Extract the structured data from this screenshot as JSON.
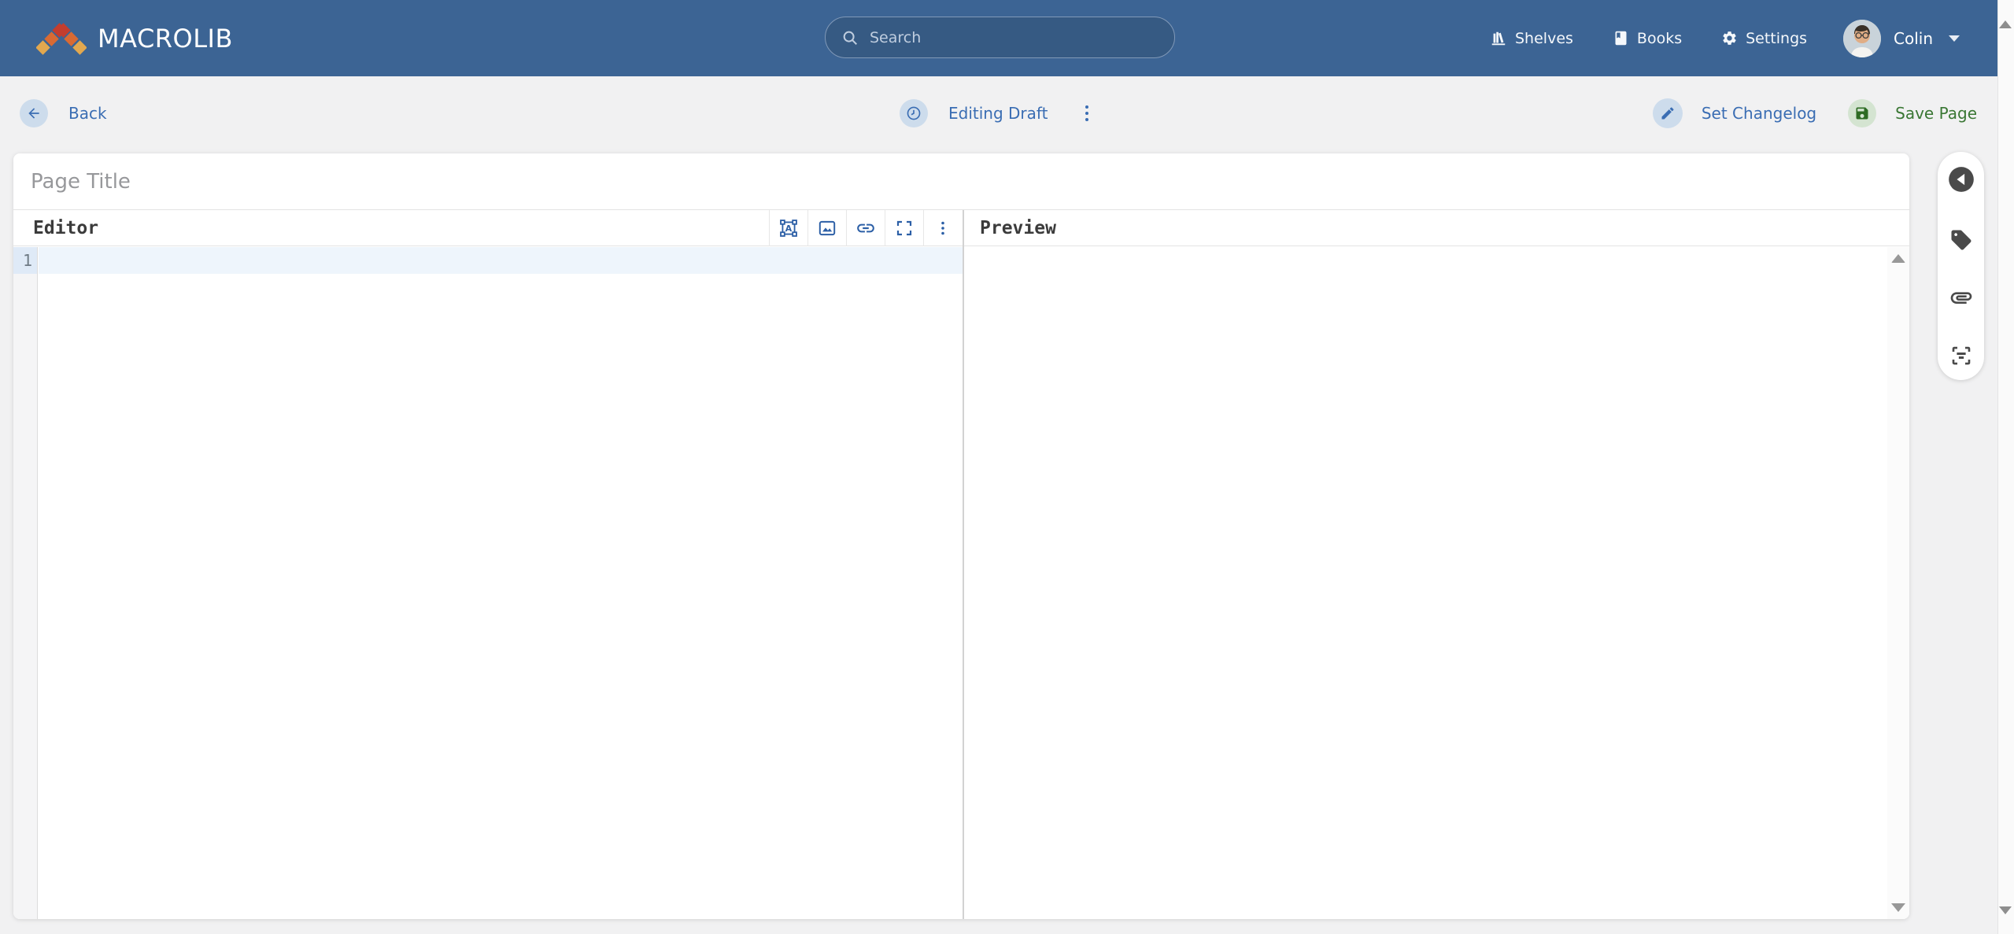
{
  "navbar": {
    "brand": "MACROLIB",
    "search": {
      "placeholder": "Search"
    },
    "links": [
      {
        "label": "Shelves",
        "icon": "shelves-icon"
      },
      {
        "label": "Books",
        "icon": "book-icon"
      },
      {
        "label": "Settings",
        "icon": "gear-icon"
      }
    ],
    "user": {
      "name": "Colin"
    }
  },
  "action_bar": {
    "back": "Back",
    "draft_status": "Editing Draft",
    "set_changelog": "Set Changelog",
    "save": "Save Page"
  },
  "editor": {
    "title_placeholder": "Page Title",
    "editor_label": "Editor",
    "preview_label": "Preview",
    "toolbar_icons": [
      "drawing-icon",
      "image-icon",
      "link-icon",
      "fullscreen-icon",
      "more-options-icon"
    ],
    "line_numbers": [
      "1"
    ],
    "content": ""
  },
  "side_toolbar_icons": [
    "toggle-panel-icon",
    "tags-icon",
    "attachments-icon",
    "templates-icon"
  ],
  "colors": {
    "navbar_blue": "#3c6494",
    "link_blue": "#3a6db3",
    "save_green": "#3a7734",
    "editor_icon_blue": "#2c5fa6",
    "circle_blue": "#cddcec",
    "circle_green": "#d4e4d1",
    "logo_gold": "#e2a84f",
    "logo_orange": "#d96a33",
    "logo_red": "#c33d2e"
  }
}
